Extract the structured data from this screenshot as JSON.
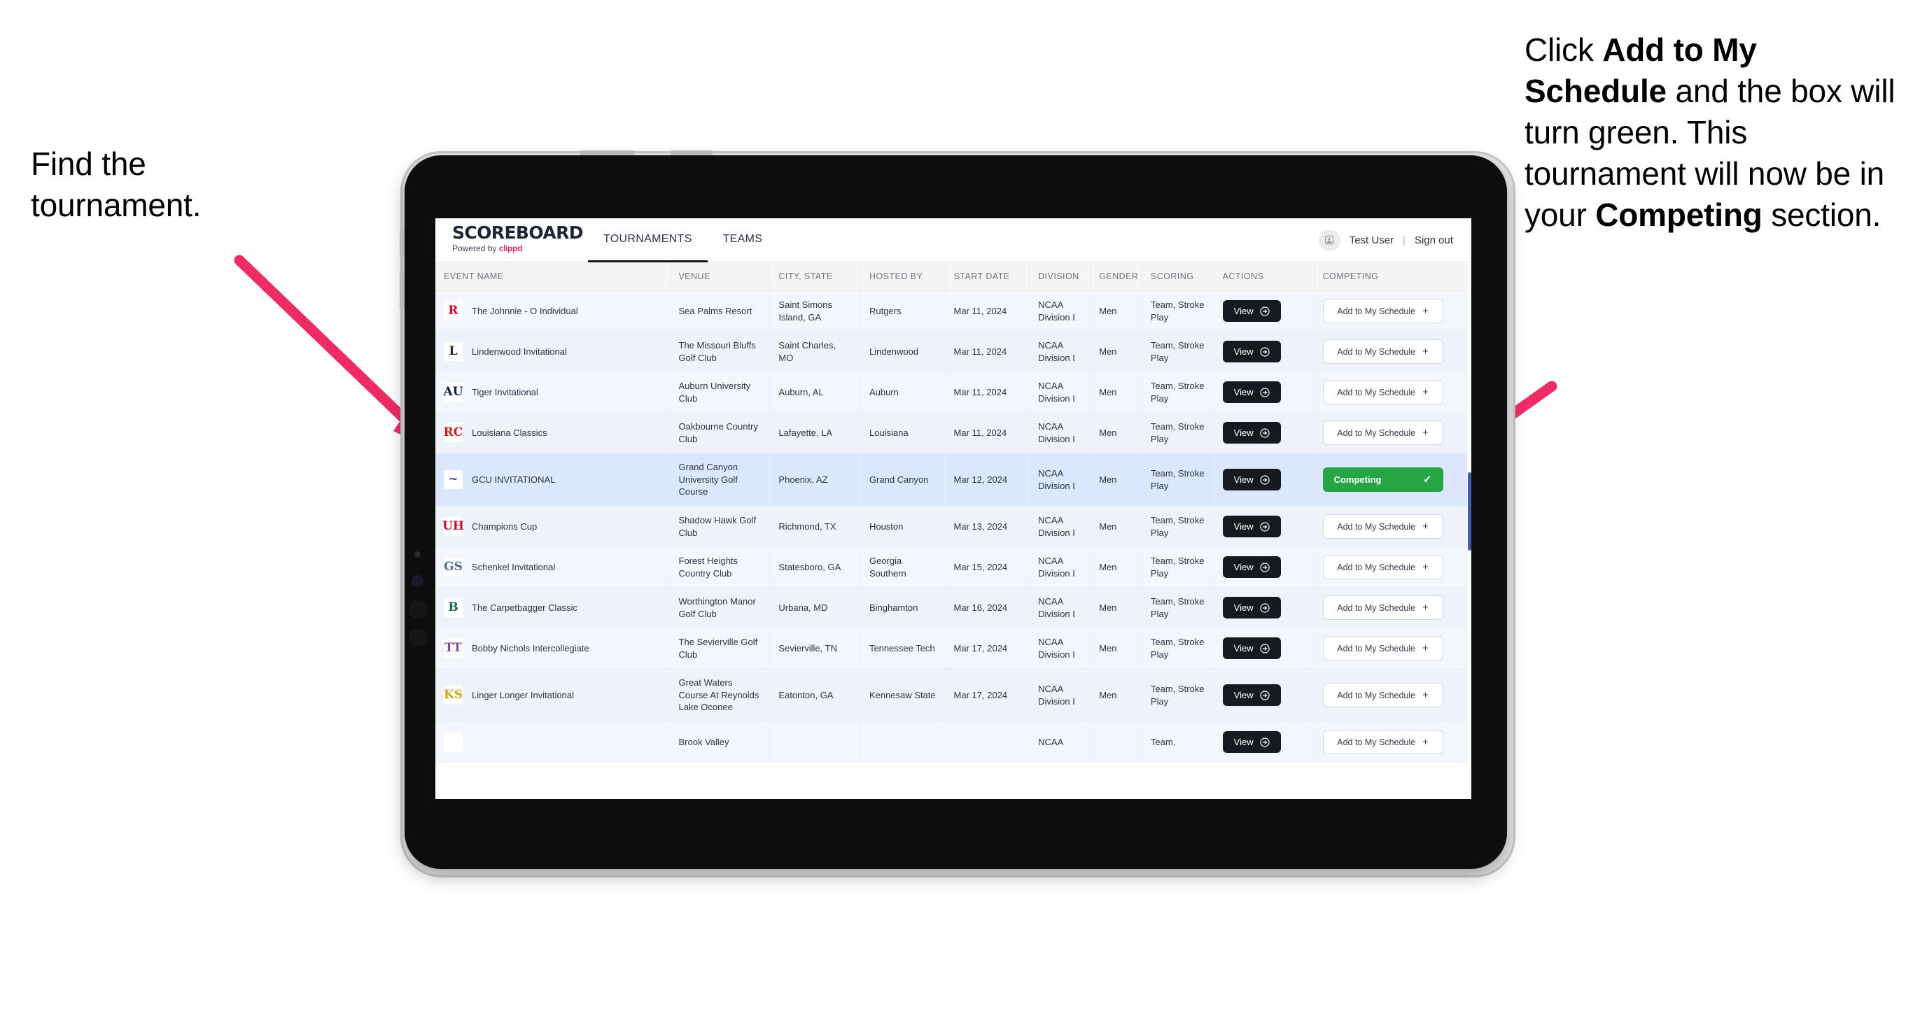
{
  "annotations": {
    "left": {
      "line1": "Find the",
      "line2": "tournament."
    },
    "right": {
      "seg1": "Click ",
      "bold1": "Add to My Schedule",
      "seg2": " and the box will turn green. This tournament will now be in your ",
      "bold2": "Competing",
      "seg3": " section."
    },
    "arrow_color": "#ED2B64"
  },
  "app": {
    "brand": {
      "title": "SCOREBOARD",
      "powered_prefix": "Powered by ",
      "powered_brand": "clippd"
    },
    "tabs": [
      {
        "label": "TOURNAMENTS",
        "active": true
      },
      {
        "label": "TEAMS",
        "active": false
      }
    ],
    "header_right": {
      "avatar_icon": "user-avatar-icon",
      "user_name": "Test User",
      "separator": "|",
      "sign_out": "Sign out"
    }
  },
  "table": {
    "columns": [
      "EVENT NAME",
      "VENUE",
      "CITY, STATE",
      "HOSTED BY",
      "START DATE",
      "DIVISION",
      "GENDER",
      "SCORING",
      "ACTIONS",
      "COMPETING"
    ],
    "view_label": "View",
    "add_label": "Add to My Schedule",
    "competing_label": "Competing",
    "rows": [
      {
        "event": "The Johnnie - O Individual",
        "logo_text": "R",
        "logo_bg": "#ffffff",
        "logo_fg": "#CC0033",
        "venue": "Sea Palms Resort",
        "city": "Saint Simons Island, GA",
        "hosted_by": "Rutgers",
        "start_date": "Mar 11, 2024",
        "division": "NCAA Division I",
        "gender": "Men",
        "scoring": "Team, Stroke Play",
        "competing": false
      },
      {
        "event": "Lindenwood Invitational",
        "logo_text": "L",
        "logo_bg": "#ffffff",
        "logo_fg": "#2E2A22",
        "venue": "The Missouri Bluffs Golf Club",
        "city": "Saint Charles, MO",
        "hosted_by": "Lindenwood",
        "start_date": "Mar 11, 2024",
        "division": "NCAA Division I",
        "gender": "Men",
        "scoring": "Team, Stroke Play",
        "competing": false
      },
      {
        "event": "Tiger Invitational",
        "logo_text": "AU",
        "logo_bg": "#ffffff",
        "logo_fg": "#0C2340",
        "venue": "Auburn University Club",
        "city": "Auburn, AL",
        "hosted_by": "Auburn",
        "start_date": "Mar 11, 2024",
        "division": "NCAA Division I",
        "gender": "Men",
        "scoring": "Team, Stroke Play",
        "competing": false
      },
      {
        "event": "Louisiana Classics",
        "logo_text": "RC",
        "logo_bg": "#ffffff",
        "logo_fg": "#CE181E",
        "venue": "Oakbourne Country Club",
        "city": "Lafayette, LA",
        "hosted_by": "Louisiana",
        "start_date": "Mar 11, 2024",
        "division": "NCAA Division I",
        "gender": "Men",
        "scoring": "Team, Stroke Play",
        "competing": false
      },
      {
        "event": "GCU INVITATIONAL",
        "logo_text": "~",
        "logo_bg": "#ffffff",
        "logo_fg": "#522398",
        "venue": "Grand Canyon University Golf Course",
        "city": "Phoenix, AZ",
        "hosted_by": "Grand Canyon",
        "start_date": "Mar 12, 2024",
        "division": "NCAA Division I",
        "gender": "Men",
        "scoring": "Team, Stroke Play",
        "competing": true,
        "selected": true
      },
      {
        "event": "Champions Cup",
        "logo_text": "UH",
        "logo_bg": "#ffffff",
        "logo_fg": "#C8102E",
        "venue": "Shadow Hawk Golf Club",
        "city": "Richmond, TX",
        "hosted_by": "Houston",
        "start_date": "Mar 13, 2024",
        "division": "NCAA Division I",
        "gender": "Men",
        "scoring": "Team, Stroke Play",
        "competing": false
      },
      {
        "event": "Schenkel Invitational",
        "logo_text": "GS",
        "logo_bg": "#ffffff",
        "logo_fg": "#4E6A86",
        "venue": "Forest Heights Country Club",
        "city": "Statesboro, GA",
        "hosted_by": "Georgia Southern",
        "start_date": "Mar 15, 2024",
        "division": "NCAA Division I",
        "gender": "Men",
        "scoring": "Team, Stroke Play",
        "competing": false
      },
      {
        "event": "The Carpetbagger Classic",
        "logo_text": "B",
        "logo_bg": "#ffffff",
        "logo_fg": "#0F6B4F",
        "venue": "Worthington Manor Golf Club",
        "city": "Urbana, MD",
        "hosted_by": "Binghamton",
        "start_date": "Mar 16, 2024",
        "division": "NCAA Division I",
        "gender": "Men",
        "scoring": "Team, Stroke Play",
        "competing": false
      },
      {
        "event": "Bobby Nichols Intercollegiate",
        "logo_text": "TT",
        "logo_bg": "#ffffff",
        "logo_fg": "#7B4FA0",
        "venue": "The Sevierville Golf Club",
        "city": "Sevierville, TN",
        "hosted_by": "Tennessee Tech",
        "start_date": "Mar 17, 2024",
        "division": "NCAA Division I",
        "gender": "Men",
        "scoring": "Team, Stroke Play",
        "competing": false
      },
      {
        "event": "Linger Longer Invitational",
        "logo_text": "KS",
        "logo_bg": "#ffffff",
        "logo_fg": "#C8A51B",
        "venue": "Great Waters Course At Reynolds Lake Oconee",
        "city": "Eatonton, GA",
        "hosted_by": "Kennesaw State",
        "start_date": "Mar 17, 2024",
        "division": "NCAA Division I",
        "gender": "Men",
        "scoring": "Team, Stroke Play",
        "competing": false
      },
      {
        "event": "",
        "logo_text": "",
        "logo_bg": "#ffffff",
        "logo_fg": "#7B4FA0",
        "venue": "Brook Valley",
        "city": "",
        "hosted_by": "",
        "start_date": "",
        "division": "NCAA",
        "gender": "",
        "scoring": "Team,",
        "competing": false,
        "partial": true
      }
    ]
  }
}
